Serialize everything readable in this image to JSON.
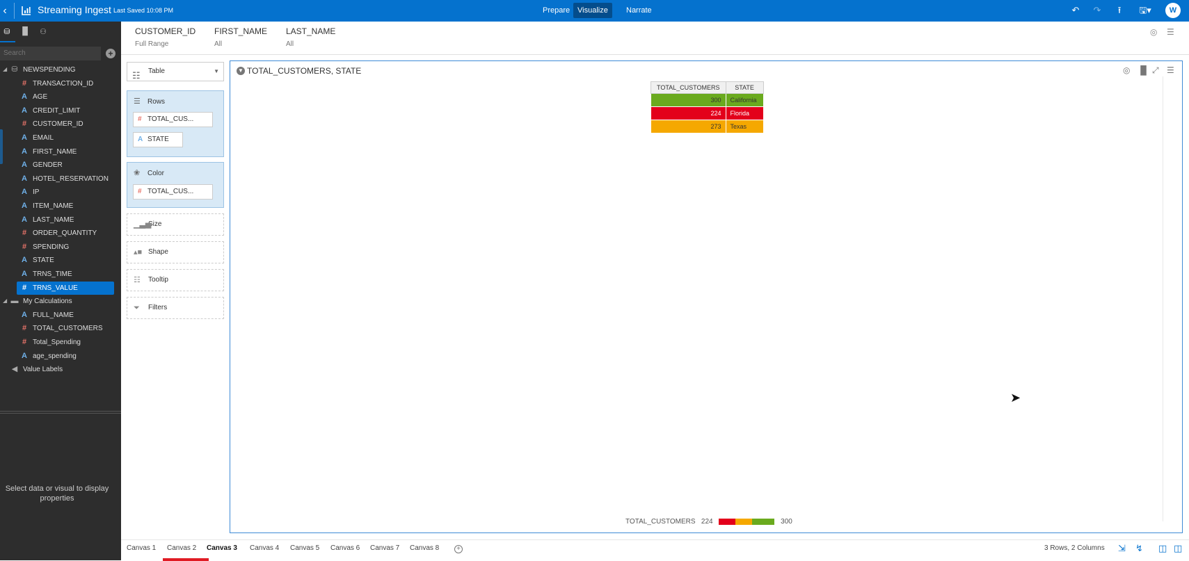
{
  "topbar": {
    "title": "Streaming Ingest",
    "last_saved": "Last Saved 10:08 PM",
    "modes": [
      "Prepare",
      "Visualize",
      "Narrate"
    ],
    "active_mode": "Visualize",
    "avatar_initial": "W"
  },
  "data_panel": {
    "search_placeholder": "Search",
    "source": "NEWSPENDING",
    "columns": [
      {
        "name": "TRANSACTION_ID",
        "kind": "num"
      },
      {
        "name": "AGE",
        "kind": "txt"
      },
      {
        "name": "CREDIT_LIMIT",
        "kind": "txt"
      },
      {
        "name": "CUSTOMER_ID",
        "kind": "num"
      },
      {
        "name": "EMAIL",
        "kind": "txt"
      },
      {
        "name": "FIRST_NAME",
        "kind": "txt"
      },
      {
        "name": "GENDER",
        "kind": "txt"
      },
      {
        "name": "HOTEL_RESERVATION",
        "kind": "txt"
      },
      {
        "name": "IP",
        "kind": "txt"
      },
      {
        "name": "ITEM_NAME",
        "kind": "txt"
      },
      {
        "name": "LAST_NAME",
        "kind": "txt"
      },
      {
        "name": "ORDER_QUANTITY",
        "kind": "num"
      },
      {
        "name": "SPENDING",
        "kind": "num"
      },
      {
        "name": "STATE",
        "kind": "txt"
      },
      {
        "name": "TRNS_TIME",
        "kind": "txt"
      },
      {
        "name": "TRNS_VALUE",
        "kind": "num",
        "selected": true
      }
    ],
    "calculations_folder": "My Calculations",
    "calculations": [
      {
        "name": "FULL_NAME",
        "kind": "txt"
      },
      {
        "name": "TOTAL_CUSTOMERS",
        "kind": "num"
      },
      {
        "name": "Total_Spending",
        "kind": "num"
      },
      {
        "name": "age_spending",
        "kind": "txt"
      }
    ],
    "value_labels": "Value Labels",
    "properties_hint": "Select data or visual to display properties"
  },
  "filters": [
    {
      "name": "CUSTOMER_ID",
      "value": "Full Range"
    },
    {
      "name": "FIRST_NAME",
      "value": "All"
    },
    {
      "name": "LAST_NAME",
      "value": "All"
    }
  ],
  "grammar": {
    "viz_type": "Table",
    "rows_label": "Rows",
    "rows_pills": [
      "TOTAL_CUS...",
      "STATE"
    ],
    "color_label": "Color",
    "color_pills": [
      "TOTAL_CUS..."
    ],
    "size_label": "Size",
    "shape_label": "Shape",
    "tooltip_label": "Tooltip",
    "filters_label": "Filters"
  },
  "canvas": {
    "title": "TOTAL_CUSTOMERS, STATE",
    "table": {
      "headers": [
        "TOTAL_CUSTOMERS",
        "STATE"
      ],
      "rows": [
        {
          "total": "300",
          "state": "California",
          "color": "#6aaa1e"
        },
        {
          "total": "224",
          "state": "Florida",
          "color": "#e3001b"
        },
        {
          "total": "273",
          "state": "Texas",
          "color": "#f5a800"
        }
      ]
    },
    "legend": {
      "label": "TOTAL_CUSTOMERS",
      "min": "224",
      "max": "300"
    }
  },
  "bottom": {
    "tabs": [
      "Canvas 1",
      "Canvas 2",
      "Canvas 3",
      "Canvas 4",
      "Canvas 5",
      "Canvas 6",
      "Canvas 7",
      "Canvas 8"
    ],
    "active_tab": "Canvas 3",
    "rows_info": "3 Rows, 2 Columns"
  }
}
